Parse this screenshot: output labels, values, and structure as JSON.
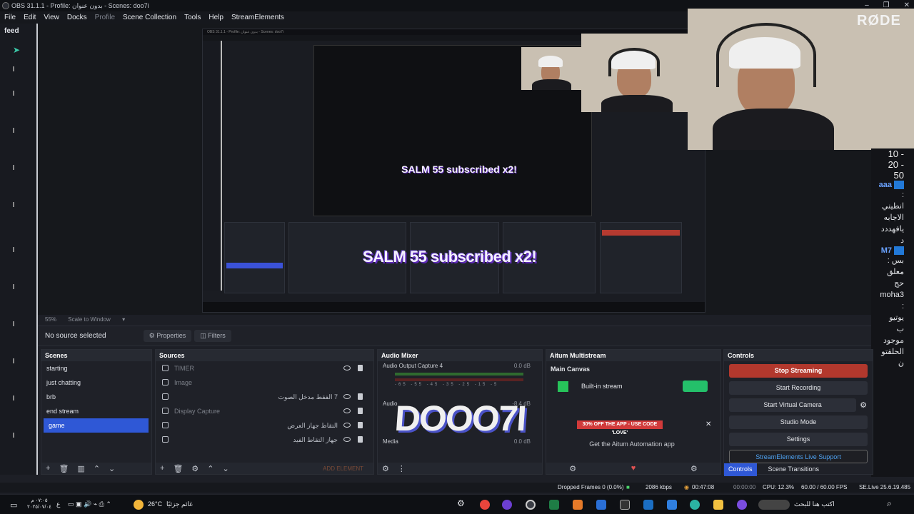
{
  "window": {
    "title": "OBS 31.1.1 - Profile: بدون عنوان - Scenes: doo7i",
    "controls": [
      "–",
      "❐",
      "✕"
    ]
  },
  "menu": [
    "File",
    "Edit",
    "View",
    "Docks",
    "Profile",
    "Scene Collection",
    "Tools",
    "Help",
    "StreamElements"
  ],
  "feed": {
    "title": "feed"
  },
  "preview": {
    "nested_title": "OBS 31.1.1 - Profile: بدون عنوان - Scenes: doo7i",
    "alert_small": "SALM 55 subscribed x2!",
    "alert_large": "SALM 55 subscribed x2!",
    "rode": "RØDE"
  },
  "chat": [
    {
      "type": "num",
      "text": "- 10"
    },
    {
      "type": "num",
      "text": "- 20"
    },
    {
      "type": "num",
      "text": "50"
    },
    {
      "type": "user",
      "text": "aaa"
    },
    {
      "type": "text",
      "text": ":"
    },
    {
      "type": "text",
      "text": "انطيني"
    },
    {
      "type": "text",
      "text": "الاجابه"
    },
    {
      "type": "text",
      "text": "يافهددد"
    },
    {
      "type": "text",
      "text": "د"
    },
    {
      "type": "user",
      "text": "M7"
    },
    {
      "type": "text",
      "text": "بس :"
    },
    {
      "type": "text",
      "text": "معلق"
    },
    {
      "type": "text",
      "text": "حج"
    },
    {
      "type": "text",
      "text": "moha3"
    },
    {
      "type": "text",
      "text": ":"
    },
    {
      "type": "text",
      "text": "يوتيو"
    },
    {
      "type": "text",
      "text": "ب"
    },
    {
      "type": "text",
      "text": "موجود"
    },
    {
      "type": "text",
      "text": "الحلقتو"
    },
    {
      "type": "text",
      "text": "ن"
    }
  ],
  "preview_bar": {
    "zoom": "55%",
    "scale": "Scale to Window"
  },
  "source_bar": {
    "label": "No source selected",
    "properties": "Properties",
    "filters": "Filters"
  },
  "scenes": {
    "title": "Scenes",
    "items": [
      "starting",
      "just chatting",
      "brb",
      "end stream",
      "game"
    ],
    "active": "game"
  },
  "sources": {
    "title": "Sources",
    "items": [
      {
        "name": "TIMER",
        "dim": true
      },
      {
        "name": "Image",
        "dim": true
      },
      {
        "name": "7 الفقط مدخل الصوت",
        "rtl": true
      },
      {
        "name": "Display Capture",
        "dim": true
      },
      {
        "name": "التقاط جهاز العرض",
        "rtl": true
      },
      {
        "name": "جهاز التقاط الفيد",
        "rtl": true
      }
    ],
    "add_element": "ADD ELEMENT"
  },
  "audio_mixer": {
    "title": "Audio Mixer",
    "channels": [
      {
        "name": "Audio Output Capture 4",
        "db": "0.0 dB"
      },
      {
        "name": "Audio",
        "db": "-8.4 dB"
      },
      {
        "name": "Media",
        "db": "0.0 dB"
      }
    ],
    "ticks": "-65 -55 -45 -35 -25 -15 -5"
  },
  "overlay_text": "DOOO7I",
  "multistream": {
    "title": "Aitum Multistream",
    "main_canvas": "Main Canvas",
    "builtin": "Built-in stream",
    "promo": "30% OFF THE APP - USE CODE 'LOVE'",
    "get_app": "Get the Aitum Automation app"
  },
  "controls": {
    "title": "Controls",
    "stop_streaming": "Stop Streaming",
    "start_recording": "Start Recording",
    "start_virtual_camera": "Start Virtual Camera",
    "studio_mode": "Studio Mode",
    "settings": "Settings",
    "se_support": "StreamElements Live Support",
    "tab_controls": "Controls",
    "tab_transitions": "Scene Transitions"
  },
  "status": {
    "dropped": "Dropped Frames 0 (0.0%)",
    "kbps": "2086 kbps",
    "live_time": "00:47:08",
    "rec_time": "00:00:00",
    "cpu": "CPU: 12.3%",
    "fps": "60.00 / 60.00 FPS",
    "se_version": "SE.Live 25.6.19.485"
  },
  "taskbar": {
    "time": "٠٧:٠٥ م",
    "date": "٢٠٢٥/٠٧/٠٤",
    "lang": "ع",
    "weather": "26°C",
    "weather_label": "غائم جزئيًا",
    "search": "اكتب هنا للبحث"
  },
  "colors": {
    "accent": "#2f58d6",
    "stop": "#b2382d",
    "toggle": "#24c06a",
    "link": "#4ea1f0"
  }
}
